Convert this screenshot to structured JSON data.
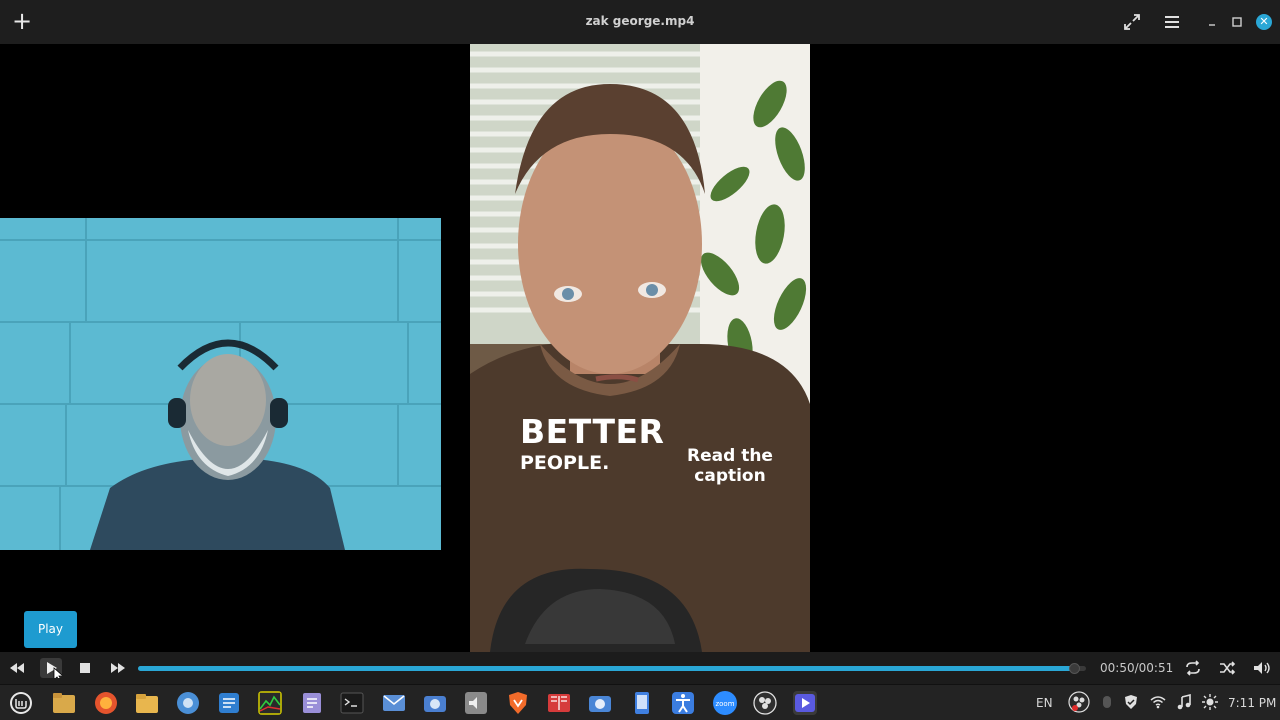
{
  "window": {
    "title": "zak george.mp4"
  },
  "video": {
    "overlay_text_large": "BETTER",
    "overlay_text_small": "PEOPLE.",
    "overlay_caption": "Read the caption"
  },
  "tooltip": {
    "label": "Play"
  },
  "player": {
    "time": "00:50/00:51",
    "progress": 0.987
  },
  "tray": {
    "language": "EN",
    "clock": "7:11 PM"
  },
  "colors": {
    "accent": "#2aa7d6",
    "titlebar": "#1e1e1e",
    "taskbar": "#232323"
  },
  "icons": {
    "titlebar": [
      "plus-icon",
      "fullscreen-icon",
      "menu-icon",
      "minimize-icon",
      "restore-icon",
      "close-icon"
    ],
    "controls": [
      "rewind-icon",
      "play-icon",
      "stop-icon",
      "fast-forward-icon",
      "repeat-icon",
      "shuffle-icon",
      "volume-icon"
    ],
    "taskbar": [
      "mint-menu-icon",
      "files-folder-icon",
      "firefox-icon",
      "folder-icon",
      "chromium-icon",
      "text-editor-icon",
      "system-monitor-icon",
      "notes-icon",
      "terminal-icon",
      "mail-icon",
      "screenshot-icon",
      "sound-icon",
      "brave-icon",
      "book-icon",
      "camera-icon",
      "phone-icon",
      "accessibility-icon",
      "zoom-icon",
      "obs-icon",
      "media-player-icon"
    ]
  }
}
